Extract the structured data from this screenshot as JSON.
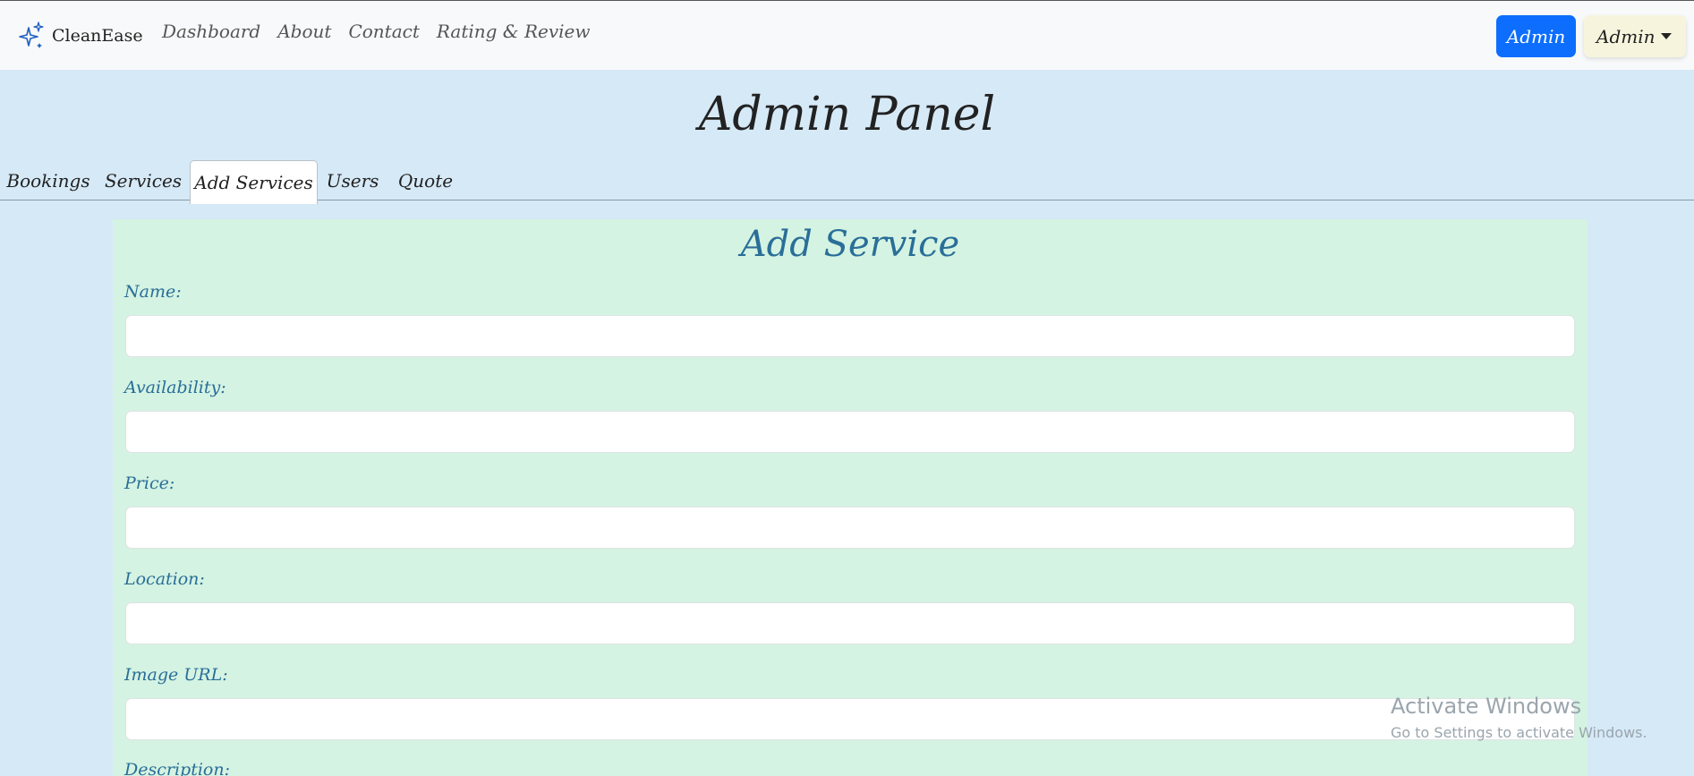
{
  "brand": {
    "name": "CleanEase",
    "icon": "sparkle-icon"
  },
  "nav": {
    "links": [
      "Dashboard",
      "About",
      "Contact",
      "Rating & Review"
    ],
    "admin_button": "Admin",
    "admin_dropdown": "Admin"
  },
  "panel": {
    "title": "Admin Panel"
  },
  "tabs": [
    "Bookings",
    "Services",
    "Add Services",
    "Users",
    "Quote"
  ],
  "active_tab": "Add Services",
  "form": {
    "title": "Add Service",
    "fields": [
      {
        "label": "Name:",
        "value": ""
      },
      {
        "label": "Availability:",
        "value": ""
      },
      {
        "label": "Price:",
        "value": ""
      },
      {
        "label": "Location:",
        "value": ""
      },
      {
        "label": "Image URL:",
        "value": ""
      },
      {
        "label": "Description:",
        "value": ""
      }
    ]
  },
  "watermark": {
    "title": "Activate Windows",
    "subtitle": "Go to Settings to activate Windows."
  },
  "colors": {
    "primary": "#0d6efd",
    "page_bg": "#d6e9f7",
    "card_bg": "#d4f3e2",
    "label": "#2a6e98"
  }
}
